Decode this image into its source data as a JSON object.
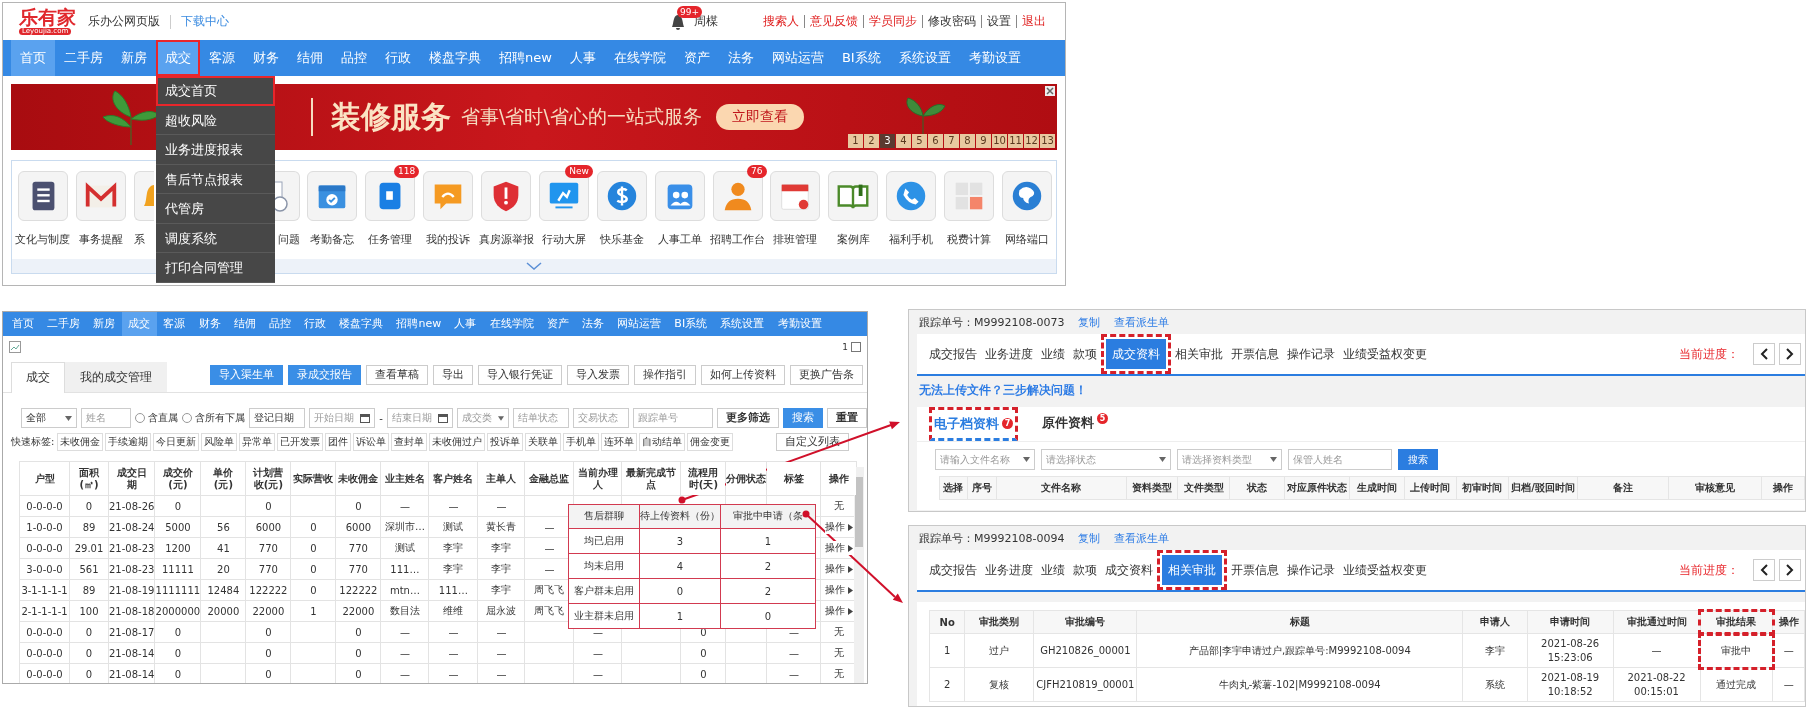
{
  "top_panel": {
    "logo": {
      "name": "乐有家",
      "domain": "Leyoujia.com"
    },
    "app_name": "乐办公网页版",
    "download_link": "下载中心",
    "notifications": "99+",
    "user": "周楳",
    "links": [
      {
        "label": "搜索人",
        "highlighted": true
      },
      {
        "label": "意见反馈",
        "highlighted": true
      },
      {
        "label": "学员同步",
        "highlighted": true
      },
      {
        "label": "修改密码",
        "highlighted": false
      },
      {
        "label": "设置",
        "highlighted": false
      },
      {
        "label": "退出",
        "highlighted": true
      }
    ],
    "nav": [
      {
        "label": "首页",
        "selected": true,
        "expanded": false,
        "annotated": false
      },
      {
        "label": "二手房",
        "selected": false,
        "expanded": false,
        "annotated": false
      },
      {
        "label": "新房",
        "selected": false,
        "expanded": false,
        "annotated": false
      },
      {
        "label": "成交",
        "selected": false,
        "expanded": true,
        "annotated": true
      },
      {
        "label": "客源",
        "selected": false,
        "expanded": false,
        "annotated": false
      },
      {
        "label": "财务",
        "selected": false,
        "expanded": false,
        "annotated": false
      },
      {
        "label": "结佣",
        "selected": false,
        "expanded": false,
        "annotated": false
      },
      {
        "label": "品控",
        "selected": false,
        "expanded": false,
        "annotated": false
      },
      {
        "label": "行政",
        "selected": false,
        "expanded": false,
        "annotated": false
      },
      {
        "label": "楼盘字典",
        "selected": false,
        "expanded": false,
        "annotated": false
      },
      {
        "label": "招聘new",
        "selected": false,
        "expanded": false,
        "annotated": false
      },
      {
        "label": "人事",
        "selected": false,
        "expanded": false,
        "annotated": false
      },
      {
        "label": "在线学院",
        "selected": false,
        "expanded": false,
        "annotated": false
      },
      {
        "label": "资产",
        "selected": false,
        "expanded": false,
        "annotated": false
      },
      {
        "label": "法务",
        "selected": false,
        "expanded": false,
        "annotated": false
      },
      {
        "label": "网站运营",
        "selected": false,
        "expanded": false,
        "annotated": false
      },
      {
        "label": "BI系统",
        "selected": false,
        "expanded": false,
        "annotated": false
      },
      {
        "label": "系统设置",
        "selected": false,
        "expanded": false,
        "annotated": false
      },
      {
        "label": "考勤设置",
        "selected": false,
        "expanded": false,
        "annotated": false
      }
    ],
    "dropdown": [
      {
        "label": "成交首页",
        "annotated": true
      },
      {
        "label": "超收风险",
        "annotated": false
      },
      {
        "label": "业务进度报表",
        "annotated": false
      },
      {
        "label": "售后节点报表",
        "annotated": false
      },
      {
        "label": "代管房",
        "annotated": false
      },
      {
        "label": "调度系统",
        "annotated": false
      },
      {
        "label": "打印合同管理",
        "annotated": false
      }
    ],
    "banner": {
      "title": "装修服务",
      "subtitle": "省事\\省时\\省心的一站式服务",
      "button": "立即查看",
      "pages": [
        {
          "label": "1",
          "selected": false
        },
        {
          "label": "2",
          "selected": false
        },
        {
          "label": "3",
          "selected": true
        },
        {
          "label": "4",
          "selected": false
        },
        {
          "label": "5",
          "selected": false
        },
        {
          "label": "6",
          "selected": false
        },
        {
          "label": "7",
          "selected": false
        },
        {
          "label": "8",
          "selected": false
        },
        {
          "label": "9",
          "selected": false
        },
        {
          "label": "10",
          "selected": false
        },
        {
          "label": "11",
          "selected": false
        },
        {
          "label": "12",
          "selected": false
        },
        {
          "label": "13",
          "selected": false
        }
      ]
    },
    "apps": [
      {
        "label": "文化与制度",
        "kind": "full"
      },
      {
        "label": "事务提醒",
        "kind": "full"
      },
      {
        "label": "系",
        "kind": "cut_right"
      },
      {
        "label": "问题",
        "kind": "cut_left"
      },
      {
        "label": "考勤备忘",
        "kind": "full"
      },
      {
        "label": "任务管理",
        "badge": "118",
        "kind": "full"
      },
      {
        "label": "我的投诉",
        "kind": "full"
      },
      {
        "label": "真房源举报",
        "kind": "full"
      },
      {
        "label": "行动大屏",
        "badge": "New",
        "kind": "full"
      },
      {
        "label": "快乐基金",
        "kind": "full"
      },
      {
        "label": "人事工单",
        "kind": "full"
      },
      {
        "label": "招聘工作台",
        "badge": "76",
        "kind": "full"
      },
      {
        "label": "排班管理",
        "kind": "full"
      },
      {
        "label": "案例库",
        "kind": "full"
      },
      {
        "label": "福利手机",
        "kind": "full"
      },
      {
        "label": "税费计算",
        "kind": "full"
      },
      {
        "label": "网络端口",
        "kind": "full"
      }
    ]
  },
  "deal_panel": {
    "nav": [
      {
        "label": "首页",
        "selected": false
      },
      {
        "label": "二手房",
        "selected": false
      },
      {
        "label": "新房",
        "selected": false
      },
      {
        "label": "成交",
        "selected": true
      },
      {
        "label": "客源",
        "selected": false
      },
      {
        "label": "财务",
        "selected": false
      },
      {
        "label": "结佣",
        "selected": false
      },
      {
        "label": "品控",
        "selected": false
      },
      {
        "label": "行政",
        "selected": false
      },
      {
        "label": "楼盘字典",
        "selected": false
      },
      {
        "label": "招聘new",
        "selected": false
      },
      {
        "label": "人事",
        "selected": false
      },
      {
        "label": "在线学院",
        "selected": false
      },
      {
        "label": "资产",
        "selected": false
      },
      {
        "label": "法务",
        "selected": false
      },
      {
        "label": "网站运营",
        "selected": false
      },
      {
        "label": "BI系统",
        "selected": false
      },
      {
        "label": "系统设置",
        "selected": false
      },
      {
        "label": "考勤设置",
        "selected": false
      }
    ],
    "page_number": "1",
    "tabs": [
      {
        "label": "成交",
        "selected": true
      },
      {
        "label": "我的成交管理",
        "selected": false
      }
    ],
    "buttons": [
      {
        "label": "导入渠生单",
        "kind": "primary"
      },
      {
        "label": "录成交报告",
        "kind": "primary"
      },
      {
        "label": "查看草稿",
        "kind": "default"
      },
      {
        "label": "导出",
        "kind": "default"
      },
      {
        "label": "导入银行凭证",
        "kind": "default"
      },
      {
        "label": "导入发票",
        "kind": "default"
      },
      {
        "label": "操作指引",
        "kind": "default"
      },
      {
        "label": "如何上传资料",
        "kind": "default"
      },
      {
        "label": "更换广告条",
        "kind": "default"
      }
    ],
    "filters": [
      {
        "kind": "select",
        "value": "全部"
      },
      {
        "kind": "input",
        "placeholder": "姓名"
      },
      {
        "kind": "radio",
        "label": "含直属",
        "checked": false
      },
      {
        "kind": "radio",
        "label": "含所有下属",
        "checked": false
      },
      {
        "kind": "select",
        "value": "登记日期"
      },
      {
        "kind": "date",
        "placeholder": "开始日期"
      },
      {
        "kind": "text",
        "label": "-"
      },
      {
        "kind": "date",
        "placeholder": "结束日期"
      },
      {
        "kind": "select",
        "placeholder": "成交类"
      },
      {
        "kind": "select",
        "placeholder": "结单状态"
      },
      {
        "kind": "select",
        "placeholder": "交易状态"
      },
      {
        "kind": "input",
        "placeholder": "跟踪单号"
      },
      {
        "kind": "button",
        "label": "更多筛选"
      },
      {
        "kind": "primary",
        "label": "搜索"
      },
      {
        "kind": "button",
        "label": "重置"
      }
    ],
    "quick_tags": {
      "label": "快速标签:",
      "tags": [
        "未收佣金",
        "手续逾期",
        "今日更新",
        "风险单",
        "异常单",
        "已开发票",
        "团件",
        "诉讼单",
        "查封单",
        "未收佣过户",
        "投诉单",
        "关联单",
        "手机单",
        "连环单",
        "自动结单",
        "佣金变更"
      ],
      "custom_button": "自定义列表"
    },
    "table": {
      "columns": [
        "户型",
        "面积(㎡)",
        "成交日期",
        "成交价(元)",
        "单价(元)",
        "计划营收(元)",
        "实际营收",
        "未收佣金",
        "业主姓名",
        "客户姓名",
        "主单人",
        "金融总监",
        "当前办理人",
        "最新完成节点",
        "流程用时(天)",
        "分佣状态",
        "标签",
        "操作"
      ],
      "rows": [
        {
          "cells": [
            "0-0-0-0",
            "0",
            "21-08-26",
            "0",
            null,
            "0",
            null,
            "0",
            "—",
            "—",
            "—",
            null,
            null,
            null,
            null,
            null,
            null,
            "无"
          ],
          "action_menu": false
        },
        {
          "cells": [
            "1-0-0-0",
            "89",
            "21-08-24",
            "5000",
            "56",
            "6000",
            "0",
            "6000",
            "深圳市…",
            "测试",
            "黄长青",
            "—",
            null,
            null,
            null,
            null,
            null,
            "操作"
          ],
          "action_menu": true
        },
        {
          "cells": [
            "0-0-0-0",
            "29.01",
            "21-08-23",
            "1200",
            "41",
            "770",
            "0",
            "770",
            "测试",
            "李宇",
            "李宇",
            "—",
            null,
            null,
            null,
            null,
            null,
            "操作"
          ],
          "action_menu": true
        },
        {
          "cells": [
            "3-0-0-0",
            "561",
            "21-08-23",
            "11111",
            "20",
            "770",
            "0",
            "770",
            "111…",
            "李宇",
            "李宇",
            "—",
            null,
            null,
            null,
            null,
            null,
            "操作"
          ],
          "action_menu": true
        },
        {
          "cells": [
            "3-1-1-1-1",
            "89",
            "21-08-19",
            "1111111",
            "12484",
            "122222",
            "0",
            "122222",
            "mtn…",
            "111…",
            "李宇",
            "周飞飞",
            null,
            null,
            null,
            null,
            null,
            "操作"
          ],
          "action_menu": true
        },
        {
          "cells": [
            "2-1-1-1-1",
            "100",
            "21-08-18",
            "2000000",
            "20000",
            "22000",
            "1",
            "22000",
            "数目法",
            "维维",
            "屈永波",
            "周飞飞",
            null,
            null,
            null,
            null,
            null,
            "操作"
          ],
          "action_menu": true
        },
        {
          "cells": [
            "0-0-0-0",
            "0",
            "21-08-17",
            "0",
            null,
            "0",
            null,
            "0",
            "—",
            "—",
            "—",
            null,
            "—",
            null,
            "0",
            null,
            "—",
            "无"
          ],
          "action_menu": false
        },
        {
          "cells": [
            "0-0-0-0",
            "0",
            "21-08-14",
            "0",
            null,
            "0",
            null,
            "0",
            "—",
            "—",
            "—",
            null,
            "—",
            null,
            "0",
            null,
            "—",
            "无"
          ],
          "action_menu": false
        },
        {
          "cells": [
            "0-0-0-0",
            "0",
            "21-08-14",
            "0",
            null,
            "0",
            null,
            "0",
            "—",
            "—",
            "—",
            null,
            "—",
            null,
            "0",
            null,
            "—",
            "无"
          ],
          "action_menu": false
        }
      ]
    },
    "popup": {
      "columns": [
        "售后群聊",
        "待上传资料（份）",
        "审批中申请（条"
      ],
      "rows": [
        [
          "均已启用",
          "3",
          "1"
        ],
        [
          "均未启用",
          "4",
          "2"
        ],
        [
          "客户群未启用",
          "0",
          "2"
        ],
        [
          "业主群未启用",
          "1",
          "0"
        ]
      ]
    }
  },
  "materials_panel": {
    "tracking": "跟踪单号：M9992108-0073",
    "links": [
      "复制",
      "查看派生单"
    ],
    "tabs": [
      {
        "label": "成交报告",
        "selected": false,
        "annotated": false
      },
      {
        "label": "业务进度",
        "selected": false,
        "annotated": false
      },
      {
        "label": "业绩",
        "selected": false,
        "annotated": false
      },
      {
        "label": "款项",
        "selected": false,
        "annotated": false
      },
      {
        "label": "成交资料",
        "selected": true,
        "annotated": true
      },
      {
        "label": "相关审批",
        "selected": false,
        "annotated": false
      },
      {
        "label": "开票信息",
        "selected": false,
        "annotated": false
      },
      {
        "label": "操作记录",
        "selected": false,
        "annotated": false
      },
      {
        "label": "业绩受益权变更",
        "selected": false,
        "annotated": false
      }
    ],
    "progress_label": "当前进度：",
    "help_link": "无法上传文件？三步解决问题！",
    "subtabs": [
      {
        "label": "电子档资料",
        "badge": "7",
        "selected": true,
        "annotated": true
      },
      {
        "label": "原件资料",
        "badge": "5",
        "selected": false,
        "annotated": false
      }
    ],
    "filters": [
      {
        "kind": "select",
        "placeholder": "请输入文件名称"
      },
      {
        "kind": "select",
        "placeholder": "请选择状态"
      },
      {
        "kind": "select",
        "placeholder": "请选择资料类型"
      },
      {
        "kind": "input",
        "placeholder": "保管人姓名"
      },
      {
        "kind": "button",
        "label": "搜索"
      }
    ],
    "table": {
      "columns": [
        "选择",
        "序号",
        "文件名称",
        "资料类型",
        "文件类型",
        "状态",
        "对应原件状态",
        "生成时间",
        "上传时间",
        "初审时间",
        "归档/驳回时间",
        "备注",
        "审核意见",
        "操作"
      ]
    }
  },
  "approvals_panel": {
    "tracking": "跟踪单号：M9992108-0094",
    "links": [
      "复制",
      "查看派生单"
    ],
    "tabs": [
      {
        "label": "成交报告",
        "selected": false,
        "annotated": false
      },
      {
        "label": "业务进度",
        "selected": false,
        "annotated": false
      },
      {
        "label": "业绩",
        "selected": false,
        "annotated": false
      },
      {
        "label": "款项",
        "selected": false,
        "annotated": false
      },
      {
        "label": "成交资料",
        "selected": false,
        "annotated": false
      },
      {
        "label": "相关审批",
        "selected": true,
        "annotated": true
      },
      {
        "label": "开票信息",
        "selected": false,
        "annotated": false
      },
      {
        "label": "操作记录",
        "selected": false,
        "annotated": false
      },
      {
        "label": "业绩受益权变更",
        "selected": false,
        "annotated": false
      }
    ],
    "progress_label": "当前进度：",
    "table": {
      "columns": [
        {
          "label": "No",
          "annotated": false
        },
        {
          "label": "审批类别",
          "annotated": false
        },
        {
          "label": "审批编号",
          "annotated": false
        },
        {
          "label": "标题",
          "annotated": false
        },
        {
          "label": "申请人",
          "annotated": false
        },
        {
          "label": "申请时间",
          "annotated": false
        },
        {
          "label": "审批通过时间",
          "annotated": false
        },
        {
          "label": "审批结果",
          "annotated": true
        },
        {
          "label": "操作",
          "annotated": false
        }
      ],
      "rows": [
        [
          "1",
          "过户",
          "GH210826_00001",
          "产品部|李宇申请过户,跟踪单号:M9992108-0094",
          "李宇",
          "2021-08-26 15:23:06",
          "—",
          "审批中",
          "—"
        ],
        [
          "2",
          "复核",
          "CJFH210819_00001",
          "牛肉丸-紫薯-102|M9992108-0094",
          "系统",
          "2021-08-19 10:18:52",
          "2021-08-22 00:15:01",
          "通过完成",
          "—"
        ]
      ]
    }
  }
}
